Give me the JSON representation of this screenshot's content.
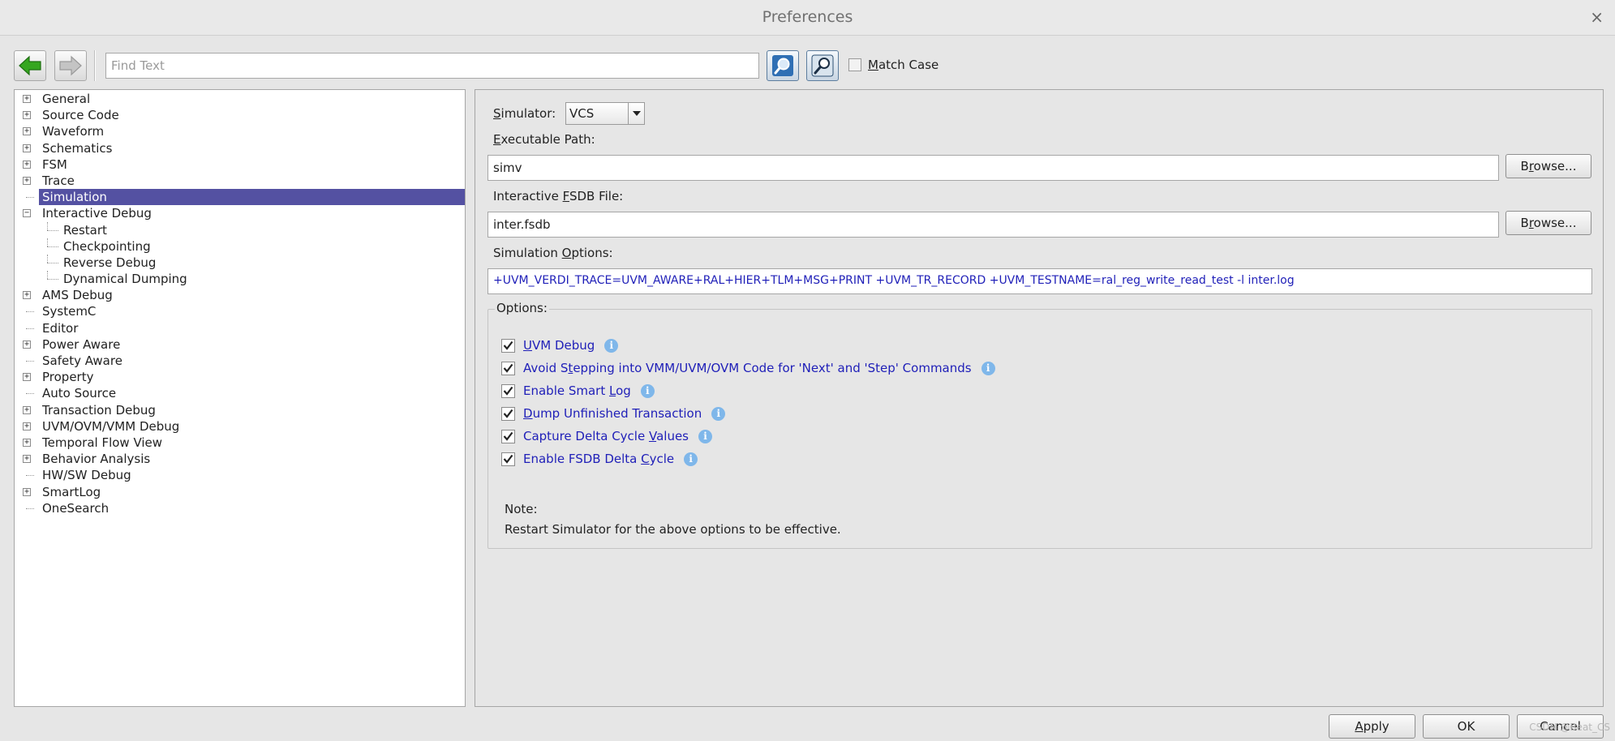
{
  "window": {
    "title": "Preferences",
    "close_glyph": "×"
  },
  "toolbar": {
    "back_icon": "green-left-arrow-icon",
    "forward_icon": "gray-right-arrow-icon",
    "find_placeholder": "Find Text",
    "find_value": "",
    "find_next_icon": "magnifier-icon",
    "find_filter_icon": "magnifier-filter-icon",
    "match_case_prefix": "",
    "match_case_mnemonic": "M",
    "match_case_rest": "atch Case",
    "match_case_checked": false
  },
  "tree": {
    "items": [
      {
        "label": "General",
        "expander": "+"
      },
      {
        "label": "Source Code",
        "expander": "+"
      },
      {
        "label": "Waveform",
        "expander": "+"
      },
      {
        "label": "Schematics",
        "expander": "+"
      },
      {
        "label": "FSM",
        "expander": "+"
      },
      {
        "label": "Trace",
        "expander": "+"
      },
      {
        "label": "Simulation",
        "expander": ""
      },
      {
        "label": "Interactive Debug",
        "expander": "−"
      },
      {
        "label": "Restart",
        "expander": ""
      },
      {
        "label": "Checkpointing",
        "expander": ""
      },
      {
        "label": "Reverse Debug",
        "expander": ""
      },
      {
        "label": "Dynamical Dumping",
        "expander": ""
      },
      {
        "label": "AMS Debug",
        "expander": "+"
      },
      {
        "label": "SystemC",
        "expander": ""
      },
      {
        "label": "Editor",
        "expander": ""
      },
      {
        "label": "Power Aware",
        "expander": "+"
      },
      {
        "label": "Safety Aware",
        "expander": ""
      },
      {
        "label": "Property",
        "expander": "+"
      },
      {
        "label": "Auto Source",
        "expander": ""
      },
      {
        "label": "Transaction Debug",
        "expander": "+"
      },
      {
        "label": "UVM/OVM/VMM Debug",
        "expander": "+"
      },
      {
        "label": "Temporal Flow View",
        "expander": "+"
      },
      {
        "label": "Behavior Analysis",
        "expander": "+"
      },
      {
        "label": "HW/SW Debug",
        "expander": ""
      },
      {
        "label": "SmartLog",
        "expander": "+"
      },
      {
        "label": "OneSearch",
        "expander": ""
      }
    ],
    "selected": "Simulation"
  },
  "simulation": {
    "simulator_label_m": "S",
    "simulator_label_rest": "imulator:",
    "simulator_value": "VCS",
    "exec_path_label_m": "E",
    "exec_path_label_rest": "xecutable Path:",
    "exec_path_value": "simv",
    "fsdb_label_pre": "Interactive ",
    "fsdb_label_m": "F",
    "fsdb_label_rest": "SDB File:",
    "fsdb_value": "inter.fsdb",
    "sim_options_label_pre": "Simulation ",
    "sim_options_label_m": "O",
    "sim_options_label_rest": "ptions:",
    "sim_options_value": "+UVM_VERDI_TRACE=UVM_AWARE+RAL+HIER+TLM+MSG+PRINT +UVM_TR_RECORD +UVM_TESTNAME=ral_reg_write_read_test -l inter.log",
    "browse_pre": "Browse...",
    "browse_mnemonic": "r",
    "browse_label_1_pre": "B",
    "browse_label_1_rest": "owse...",
    "browse_label_2_pre": "B",
    "browse_label_2_rest": "owse..."
  },
  "options": {
    "legend": "Options:",
    "items": [
      {
        "pre": "",
        "m": "U",
        "rest": "VM Debug",
        "checked": true
      },
      {
        "pre": "Avoid S",
        "m": "t",
        "rest": "epping into VMM/UVM/OVM Code for 'Next' and 'Step' Commands",
        "checked": true
      },
      {
        "pre": "Enable Smart ",
        "m": "L",
        "rest": "og",
        "checked": true
      },
      {
        "pre": "",
        "m": "D",
        "rest": "ump Unfinished Transaction",
        "checked": true
      },
      {
        "pre": "Capture Delta Cycle ",
        "m": "V",
        "rest": "alues",
        "checked": true
      },
      {
        "pre": "Enable FSDB Delta ",
        "m": "C",
        "rest": "ycle",
        "checked": true
      }
    ],
    "info_glyph": "i",
    "note_label": "Note:",
    "note_text": "Restart Simulator for the above options to be effective."
  },
  "footer": {
    "apply_m": "A",
    "apply_rest": "pply",
    "ok": "OK",
    "cancel": "Cancel",
    "watermark": "CSDN @Beat_CS"
  },
  "colors": {
    "selection": "#5451a2",
    "link_text": "#1f1fb8",
    "info_icon": "#7fb7ea",
    "back_arrow": "#2e9d1c"
  }
}
